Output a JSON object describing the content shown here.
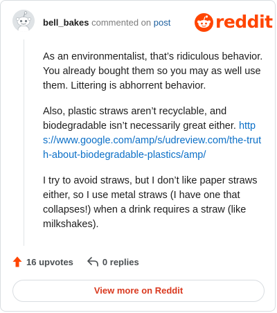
{
  "header": {
    "username": "bell_bakes",
    "action_text": "commented on",
    "post_link": "post",
    "avatar_icon": "snoo-avatar-icon"
  },
  "brand": {
    "wordmark": "reddit",
    "color": "#ff4500",
    "logo_icon": "reddit-snoo-icon"
  },
  "comment": {
    "paragraph1": "As an environmentalist, that’s ridiculous behavior. You already bought them so you may as well use them. Littering is abhorrent behavior.",
    "paragraph2_text": "Also, plastic straws aren’t recyclable, and biodegradable isn’t necessarily great either.",
    "paragraph2_link": "https://www.google.com/amp/s/udreview.com/the-truth-about-biodegradable-plastics/amp/",
    "paragraph3": "I try to avoid straws, but I don’t like paper straws either, so I use metal straws (I have one that collapses!) when a drink requires a straw (like milkshakes)."
  },
  "actions": {
    "upvotes_label": "16 upvotes",
    "replies_label": "0 replies",
    "upvote_icon": "upvote-arrow-icon",
    "reply_icon": "reply-arrow-icon",
    "upvote_color": "#ff4500"
  },
  "footer": {
    "view_more_label": "View more on Reddit"
  }
}
